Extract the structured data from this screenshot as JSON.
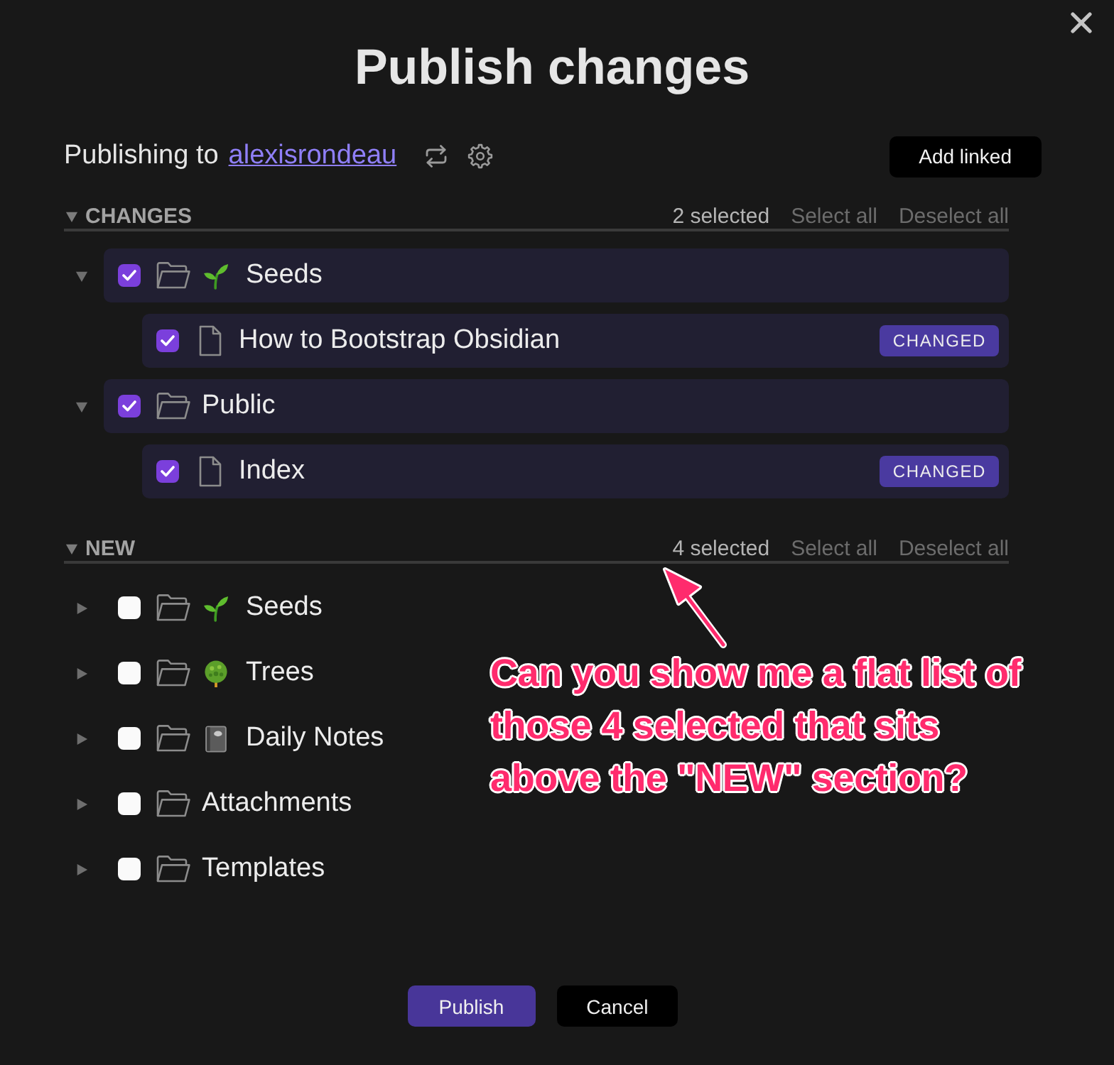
{
  "dialog": {
    "title": "Publish changes"
  },
  "publish_target": {
    "label": "Publishing to",
    "account": "alexisrondeau",
    "action": "Add linked"
  },
  "sections": [
    {
      "title": "CHANGES",
      "expanded": true,
      "count": "2 selected",
      "select_all": "Select all",
      "deselect_all": "Deselect all",
      "items": [
        {
          "kind": "folder",
          "name": "Seeds",
          "expanded": true,
          "checked": true,
          "children": [
            {
              "kind": "file",
              "name": "How to Bootstrap Obsidian",
              "checked": true,
              "badge": "CHANGED"
            }
          ]
        },
        {
          "kind": "folder",
          "name": "Public",
          "expanded": true,
          "checked": true,
          "children": [
            {
              "kind": "file",
              "name": "Index",
              "checked": true,
              "badge": "CHANGED"
            }
          ]
        }
      ]
    },
    {
      "title": "NEW",
      "expanded": true,
      "count": "4 selected",
      "select_all": "Select all",
      "deselect_all": "Deselect all",
      "items": [
        {
          "kind": "folder",
          "name": "Seeds",
          "expanded": false,
          "checked": false
        },
        {
          "kind": "folder",
          "name": "Trees",
          "expanded": false,
          "checked": false
        },
        {
          "kind": "folder",
          "name": "Daily Notes",
          "expanded": false,
          "checked": false
        },
        {
          "kind": "folder",
          "name": "Attachments",
          "expanded": false,
          "checked": false
        },
        {
          "kind": "folder",
          "name": "Templates",
          "expanded": false,
          "checked": false
        }
      ]
    }
  ],
  "annotation": {
    "text": "Can you show me a flat list of those 4 selected that sits above the \"NEW\" section?"
  },
  "buttons": [
    {
      "label": "Publish",
      "kind": "primary"
    },
    {
      "label": "Cancel",
      "kind": "secondary"
    }
  ]
}
